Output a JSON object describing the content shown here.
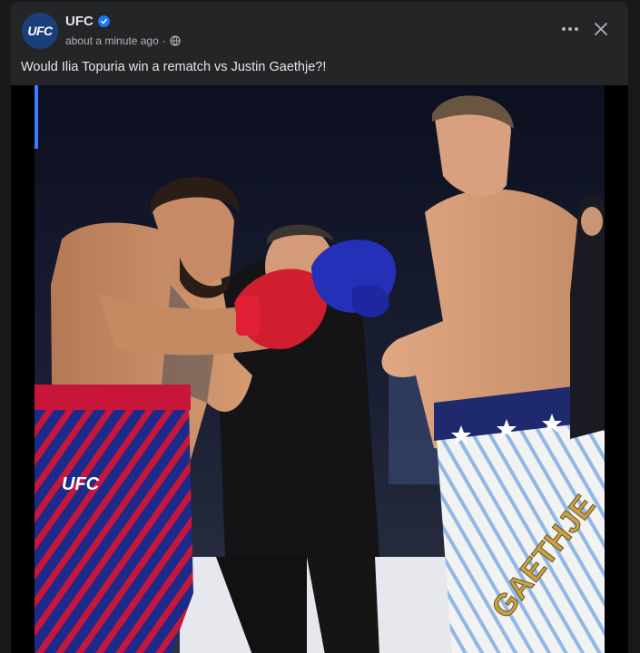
{
  "post": {
    "author": "UFC",
    "avatar_text": "UFC",
    "timestamp": "about a minute ago",
    "separator": "·",
    "caption": "Would Ilia Topuria win a rematch vs Justin Gaethje?!"
  },
  "photo": {
    "left_shorts_text": "UFC",
    "right_shorts_text": "GAETHJE"
  },
  "colors": {
    "background": "#18191a",
    "card": "#242526",
    "primary_text": "#e4e6eb",
    "secondary_text": "#b0b3b8",
    "verified": "#1877f2"
  },
  "icons": {
    "verified": "verified-badge-icon",
    "audience": "globe-icon",
    "more": "more-dots-icon",
    "close": "close-icon"
  }
}
